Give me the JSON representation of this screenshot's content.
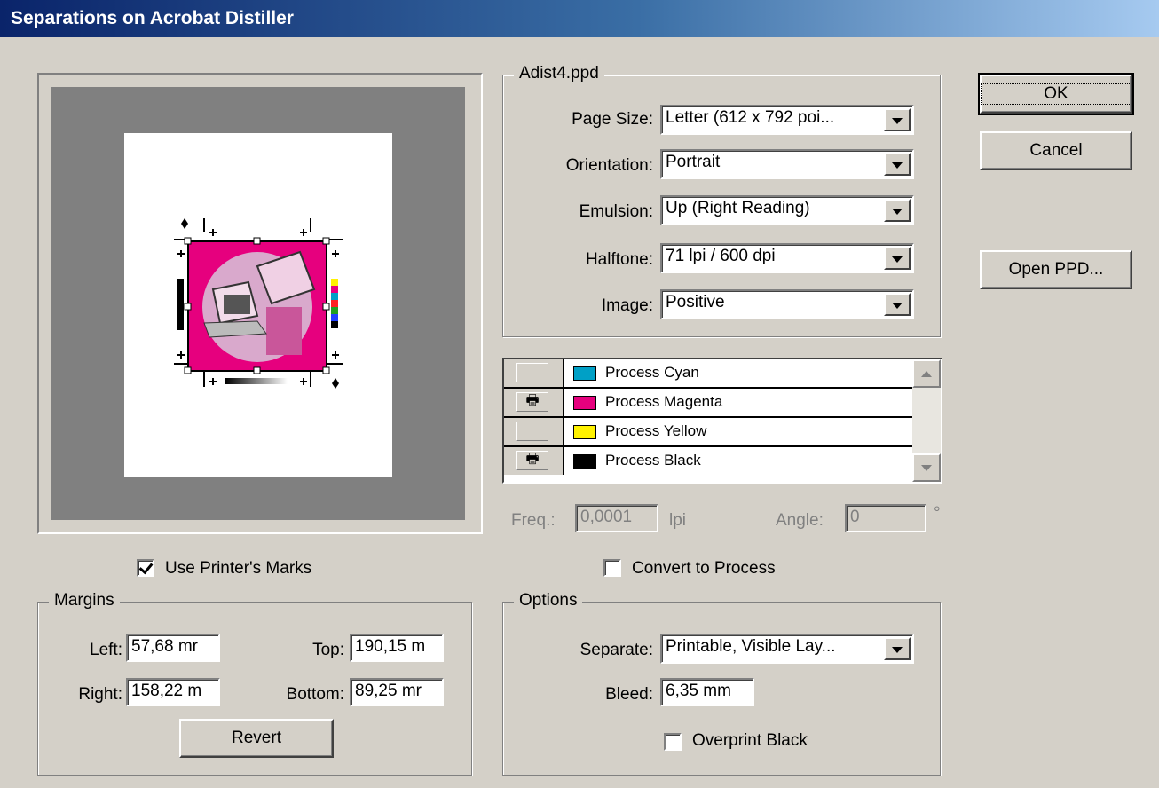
{
  "window": {
    "title": "Separations on Acrobat Distiller"
  },
  "ppd": {
    "group_title": "Adist4.ppd",
    "page_size": {
      "label": "Page Size:",
      "value": "Letter (612 x 792 poi..."
    },
    "orientation": {
      "label": "Orientation:",
      "value": "Portrait"
    },
    "emulsion": {
      "label": "Emulsion:",
      "value": "Up (Right Reading)"
    },
    "halftone": {
      "label": "Halftone:",
      "value": "71 lpi / 600 dpi"
    },
    "image": {
      "label": "Image:",
      "value": "Positive"
    }
  },
  "inks": [
    {
      "name": "Process Cyan",
      "print": false,
      "color": "#00a0c6"
    },
    {
      "name": "Process Magenta",
      "print": true,
      "color": "#e6007e"
    },
    {
      "name": "Process Yellow",
      "print": false,
      "color": "#fff200"
    },
    {
      "name": "Process Black",
      "print": true,
      "color": "#000000"
    }
  ],
  "print_icon": "printer-icon",
  "screening": {
    "freq_label": "Freq.:",
    "freq_value": "0,0001",
    "freq_unit": "lpi",
    "angle_label": "Angle:",
    "angle_value": "0",
    "angle_unit": "°"
  },
  "convert_to_process": {
    "label": "Convert to Process",
    "checked": false
  },
  "use_printers_marks": {
    "label": "Use Printer's Marks",
    "checked": true
  },
  "margins": {
    "group_title": "Margins",
    "left": {
      "label": "Left:",
      "value": "57,68 mr"
    },
    "top": {
      "label": "Top:",
      "value": "190,15 m"
    },
    "right": {
      "label": "Right:",
      "value": "158,22 m"
    },
    "bottom": {
      "label": "Bottom:",
      "value": "89,25 mr"
    },
    "revert_label": "Revert"
  },
  "options": {
    "group_title": "Options",
    "separate": {
      "label": "Separate:",
      "value": "Printable, Visible Lay..."
    },
    "bleed": {
      "label": "Bleed:",
      "value": "6,35 mm"
    },
    "overprint_black": {
      "label": "Overprint Black",
      "checked": false
    }
  },
  "buttons": {
    "ok": "OK",
    "cancel": "Cancel",
    "open_ppd": "Open PPD..."
  },
  "colors": {
    "magenta": "#e6007e",
    "titlebar_start": "#0a246a",
    "titlebar_end": "#a6caf0",
    "dialog_bg": "#d4d0c8"
  }
}
